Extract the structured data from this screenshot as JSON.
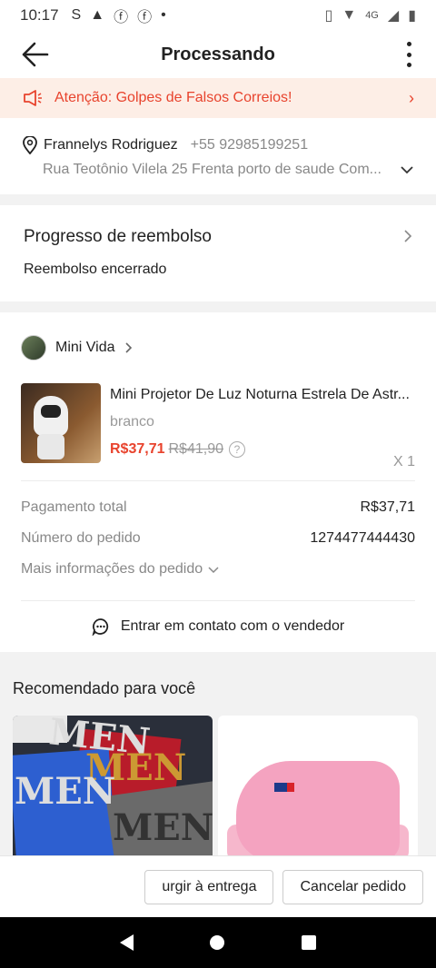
{
  "status_bar": {
    "time": "10:17",
    "network": "4G"
  },
  "header": {
    "title": "Processando"
  },
  "alert": {
    "text": "Atenção: Golpes de Falsos Correios!"
  },
  "address": {
    "name": "Frannelys Rodriguez",
    "phone": "+55 92985199251",
    "street": "Rua Teotônio Vilela 25 Frenta porto de saude Com..."
  },
  "refund": {
    "title": "Progresso de reembolso",
    "status": "Reembolso encerrado"
  },
  "order": {
    "store_name": "Mini Vida",
    "product": {
      "name": "Mini Projetor De Luz Noturna Estrela De Astr...",
      "variant": "branco",
      "price": "R$37,71",
      "old_price": "R$41,90",
      "help": "?",
      "qty": "X 1"
    },
    "details": {
      "total_label": "Pagamento total",
      "total_value": "R$37,71",
      "order_number_label": "Número do pedido",
      "order_number_value": "1274477444430",
      "more_info": "Mais informações do pedido"
    },
    "contact": "Entrar em contato com o vendedor"
  },
  "recommended": {
    "title": "Recomendado para você",
    "card1_text": "MEN"
  },
  "actions": {
    "urge": "urgir à entrega",
    "cancel": "Cancelar pedido"
  },
  "colors": {
    "accent": "#e8432d",
    "alert_bg": "#fdeee6"
  }
}
